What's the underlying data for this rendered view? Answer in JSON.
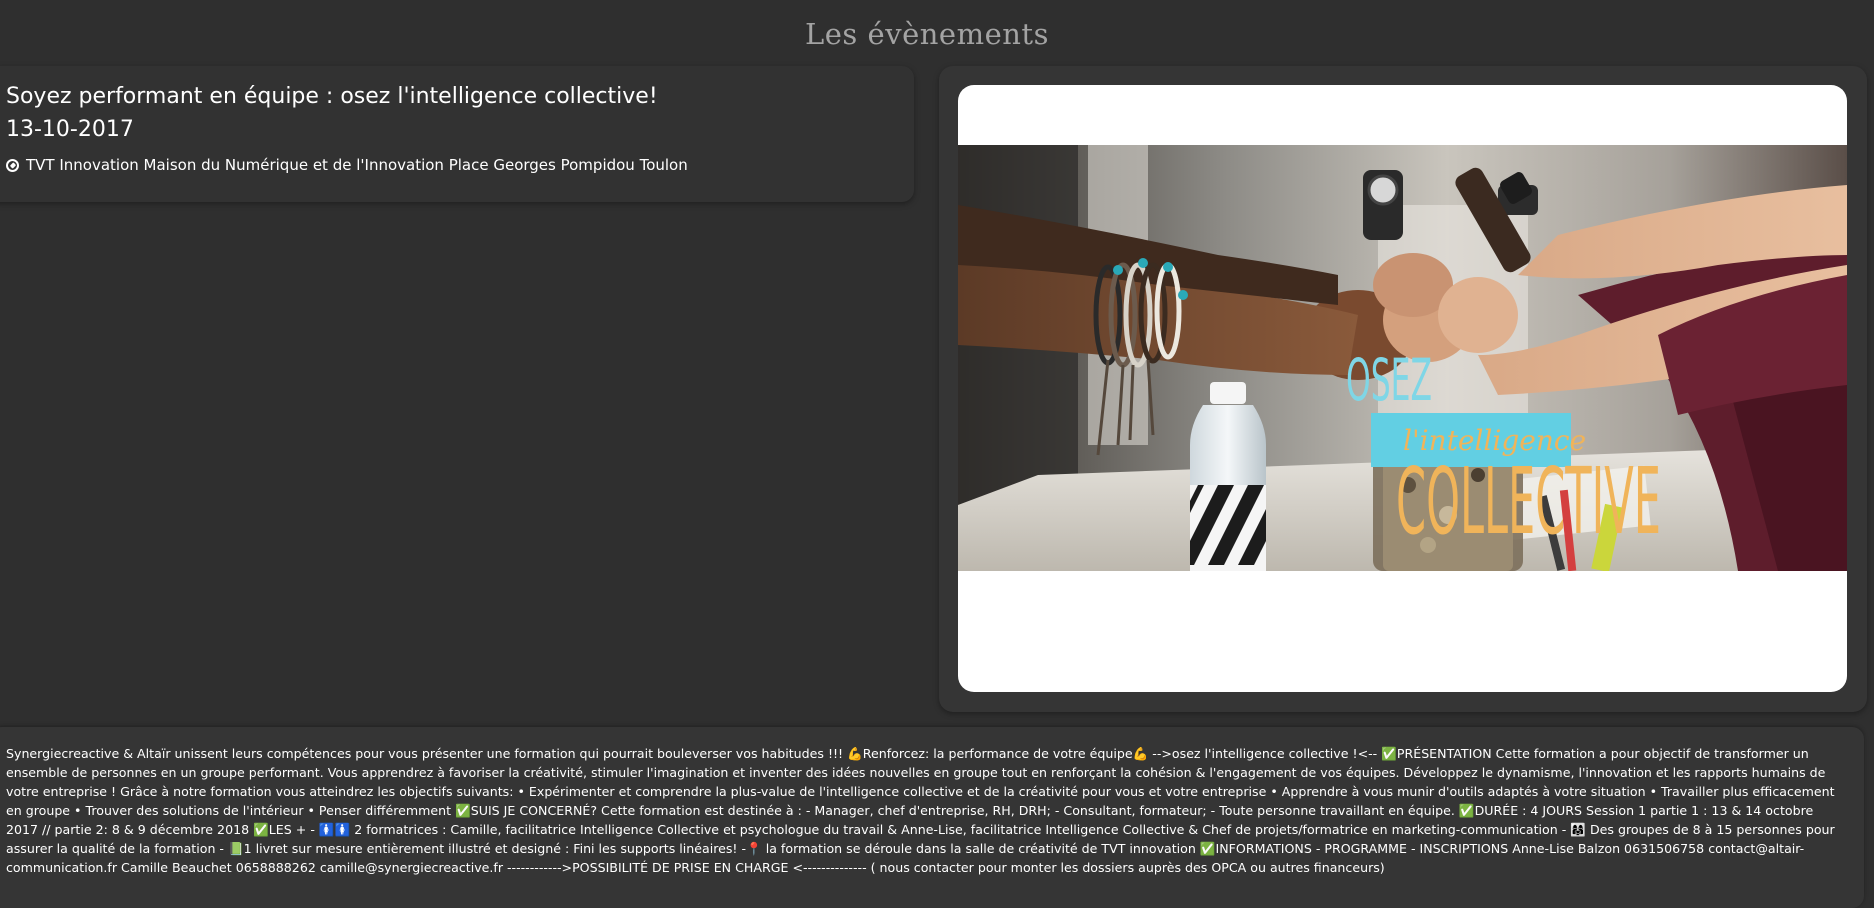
{
  "page": {
    "title": "Les évènements"
  },
  "event": {
    "title": "Soyez performant en équipe : osez l'intelligence collective!",
    "date": "13-10-2017",
    "location": "TVT Innovation Maison du Numérique et de l'Innovation Place Georges Pompidou Toulon",
    "location_icon": "compass-icon"
  },
  "banner": {
    "text_osez": "OSEZ",
    "text_intelligence": "l'intelligence",
    "text_collective": "COLLECTIVE",
    "colors": {
      "osez": "#7fd6e6",
      "tag_background": "#62cfe3",
      "collective": "#f0b45a"
    }
  },
  "description": {
    "text": "Synergiecreactive & Altaïr unissent leurs compétences pour vous présenter une formation qui pourrait bouleverser vos habitudes !!! 💪Renforcez: la performance de votre équipe💪 -->osez l'intelligence collective !<-- ✅PRÉSENTATION Cette formation a pour objectif de transformer un ensemble de personnes en un groupe performant. Vous apprendrez à favoriser la créativité, stimuler l'imagination et inventer des idées nouvelles en groupe tout en renforçant la cohésion & l'engagement de vos équipes. Développez le dynamisme, l'innovation et les rapports humains de votre entreprise ! Grâce à notre formation vous atteindrez les objectifs suivants: • Expérimenter et comprendre la plus-value de l'intelligence collective et de la créativité pour vous et votre entreprise • Apprendre à vous munir d'outils adaptés à votre situation • Travailler plus efficacement en groupe • Trouver des solutions de l'intérieur • Penser différemment ✅SUIS JE CONCERNÉ? Cette formation est destinée à : - Manager, chef d'entreprise, RH, DRH; - Consultant, formateur; - Toute personne travaillant en équipe. ✅DURÉE : 4 JOURS Session 1 partie 1 : 13 & 14 octobre 2017 // partie 2: 8 & 9 décembre 2018 ✅LES + - 🚺🚺 2 formatrices : Camille, facilitatrice Intelligence Collective et psychologue du travail & Anne-Lise, facilitatrice Intelligence Collective & Chef de projets/formatrice en marketing-communication - 👩‍👩‍👧 Des groupes de 8 à 15 personnes pour assurer la qualité de la formation - 📗1 livret sur mesure entièrement illustré et designé : Fini les supports linéaires! -📍 la formation se déroule dans la salle de créativité de TVT innovation ✅INFORMATIONS - PROGRAMME - INSCRIPTIONS Anne-Lise Balzon 0631506758 contact@altair-communication.fr Camille Beauchet 0658888262 camille@synergiecreactive.fr ------------>POSSIBILITÉ DE PRISE EN CHARGE <-------------- ( nous contacter pour monter les dossiers auprès des OPCA ou autres financeurs)"
  }
}
